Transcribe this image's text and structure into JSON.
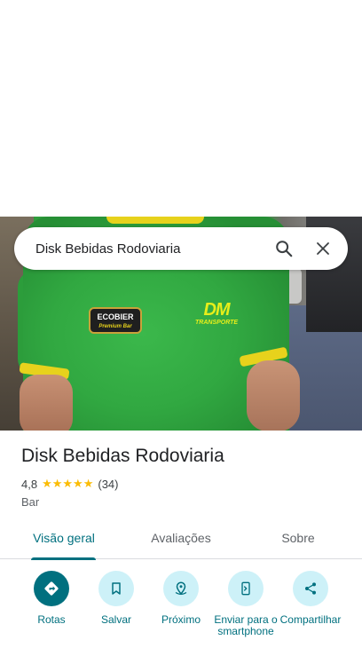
{
  "search": {
    "query": "Disk Bebidas Rodoviaria"
  },
  "photo": {
    "logo_left_text": "ECOBIER",
    "logo_left_sub": "Premium Bar",
    "logo_right_text": "DM",
    "logo_right_sub": "TRANSPORTE"
  },
  "place": {
    "name": "Disk Bebidas Rodoviaria",
    "rating": "4,8",
    "stars": "★★★★★",
    "reviews": "(34)",
    "category": "Bar"
  },
  "tabs": [
    {
      "label": "Visão geral",
      "selected": true
    },
    {
      "label": "Avaliações",
      "selected": false
    },
    {
      "label": "Sobre",
      "selected": false
    }
  ],
  "actions": [
    {
      "label": "Rotas",
      "icon": "directions-icon"
    },
    {
      "label": "Salvar",
      "icon": "bookmark-icon"
    },
    {
      "label": "Próximo",
      "icon": "nearby-icon"
    },
    {
      "label": "Enviar para o smartphone",
      "icon": "send-to-phone-icon"
    },
    {
      "label": "Compartilhar",
      "icon": "share-icon"
    }
  ],
  "colors": {
    "accent": "#00707f",
    "chip": "#cdf1f8",
    "star": "#fbbc04"
  }
}
